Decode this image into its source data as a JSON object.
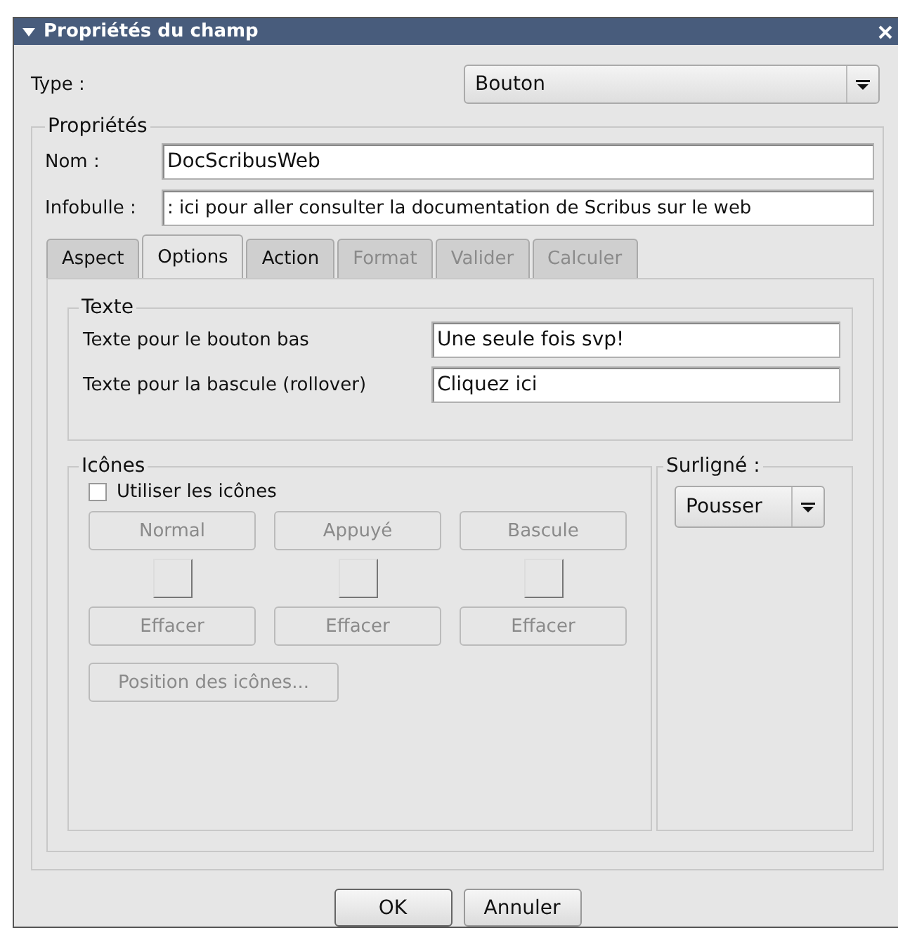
{
  "window": {
    "title": "Propriétés du champ"
  },
  "type_field": {
    "label": "Type :",
    "value": "Bouton"
  },
  "properties": {
    "legend": "Propriétés",
    "name": {
      "label": "Nom :",
      "value": "DocScribusWeb"
    },
    "tooltip": {
      "label": "Infobulle :",
      "value": ": ici pour aller consulter la documentation de Scribus sur le web"
    },
    "tabs": [
      {
        "label": "Aspect",
        "selected": false,
        "disabled": false
      },
      {
        "label": "Options",
        "selected": true,
        "disabled": false
      },
      {
        "label": "Action",
        "selected": false,
        "disabled": false
      },
      {
        "label": "Format",
        "selected": false,
        "disabled": true
      },
      {
        "label": "Valider",
        "selected": false,
        "disabled": true
      },
      {
        "label": "Calculer",
        "selected": false,
        "disabled": true
      }
    ],
    "text_group": {
      "legend": "Texte",
      "rows": [
        {
          "label": "Texte pour le bouton bas",
          "value": "Une seule fois svp!"
        },
        {
          "label": "Texte pour la bascule (rollover)",
          "value": "Cliquez ici"
        }
      ]
    },
    "icons_group": {
      "legend": "Icônes",
      "use_icons": {
        "label": "Utiliser les icônes",
        "checked": false
      },
      "columns": [
        {
          "pick": "Normal",
          "clear": "Effacer",
          "disabled": true
        },
        {
          "pick": "Appuyé",
          "clear": "Effacer",
          "disabled": true
        },
        {
          "pick": "Bascule",
          "clear": "Effacer",
          "disabled": true
        }
      ],
      "position_button": {
        "label": "Position des icônes...",
        "disabled": true
      }
    },
    "highlight": {
      "legend": "Surligné :",
      "value": "Pousser"
    }
  },
  "buttons": [
    {
      "label": "OK",
      "default": true
    },
    {
      "label": "Annuler",
      "default": false
    }
  ]
}
